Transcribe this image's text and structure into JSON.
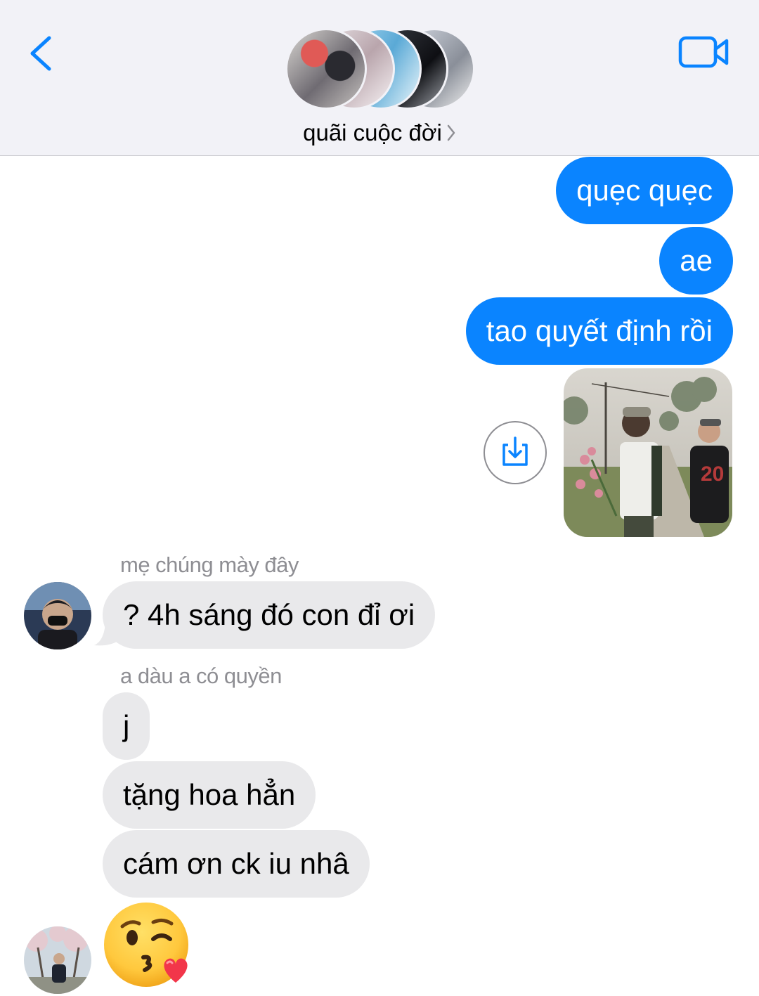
{
  "header": {
    "group_name": "quãi cuộc đời",
    "accent_color": "#0a84ff",
    "back_icon": "chevron-left-icon",
    "video_icon": "video-camera-icon"
  },
  "messages": {
    "outgoing_1": "quẹc quẹc",
    "outgoing_2": "ae",
    "outgoing_3": "tao quyết định rồi",
    "incoming_sender_1": "mẹ chúng mày đây",
    "incoming_1": "? 4h sáng đó con đỉ ơi",
    "incoming_sender_2": "a dàu a có quyền",
    "incoming_2": "j",
    "incoming_3": "tặng hoa hẳn",
    "incoming_4": "cám ơn ck iu nhâ",
    "incoming_5_emoji": "kissing-face-with-heart-emoji"
  },
  "colors": {
    "outgoing_bubble": "#0a84ff",
    "incoming_bubble": "#e9e9eb",
    "sender_text": "#8e8e93"
  }
}
